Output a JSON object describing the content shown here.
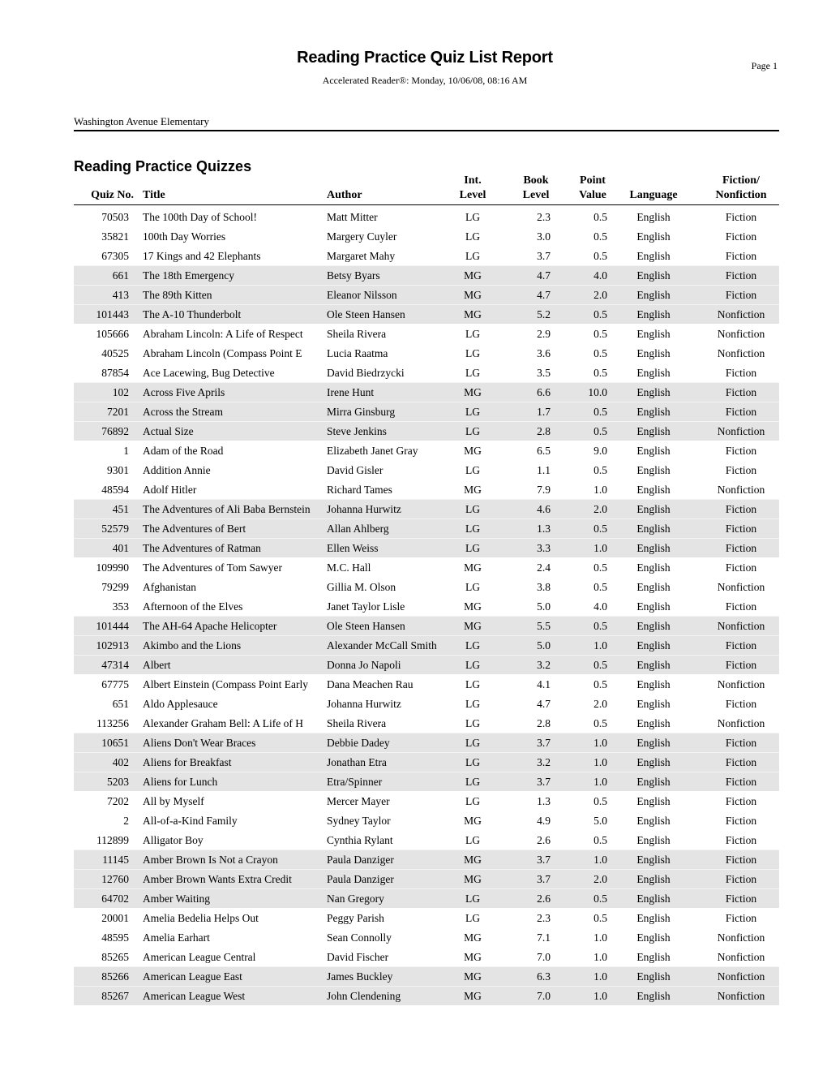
{
  "report": {
    "title": "Reading Practice Quiz List Report",
    "page_label": "Page 1",
    "subtitle": "Accelerated Reader®:  Monday, 10/06/08, 08:16 AM",
    "school": "Washington Avenue Elementary",
    "section_title": "Reading Practice Quizzes"
  },
  "table": {
    "headers": {
      "quiz_no": "Quiz No.",
      "title": "Title",
      "author": "Author",
      "int_level_1": "Int.",
      "int_level_2": "Level",
      "book_level_1": "Book",
      "book_level_2": "Level",
      "point_value_1": "Point",
      "point_value_2": "Value",
      "language": "Language",
      "fiction_1": "Fiction/",
      "fiction_2": "Nonfiction"
    },
    "shade_color": "#e4e4e4",
    "rows": [
      {
        "quiz": "70503",
        "title": "The 100th Day of School!",
        "author": "Matt Mitter",
        "int": "LG",
        "book": "2.3",
        "point": "0.5",
        "lang": "English",
        "fic": "Fiction"
      },
      {
        "quiz": "35821",
        "title": "100th Day Worries",
        "author": "Margery Cuyler",
        "int": "LG",
        "book": "3.0",
        "point": "0.5",
        "lang": "English",
        "fic": "Fiction"
      },
      {
        "quiz": "67305",
        "title": "17 Kings and 42 Elephants",
        "author": "Margaret Mahy",
        "int": "LG",
        "book": "3.7",
        "point": "0.5",
        "lang": "English",
        "fic": "Fiction"
      },
      {
        "quiz": "661",
        "title": "The 18th Emergency",
        "author": "Betsy Byars",
        "int": "MG",
        "book": "4.7",
        "point": "4.0",
        "lang": "English",
        "fic": "Fiction"
      },
      {
        "quiz": "413",
        "title": "The 89th Kitten",
        "author": "Eleanor Nilsson",
        "int": "MG",
        "book": "4.7",
        "point": "2.0",
        "lang": "English",
        "fic": "Fiction"
      },
      {
        "quiz": "101443",
        "title": "The A-10 Thunderbolt",
        "author": "Ole Steen Hansen",
        "int": "MG",
        "book": "5.2",
        "point": "0.5",
        "lang": "English",
        "fic": "Nonfiction"
      },
      {
        "quiz": "105666",
        "title": "Abraham Lincoln: A Life of Respect",
        "author": "Sheila Rivera",
        "int": "LG",
        "book": "2.9",
        "point": "0.5",
        "lang": "English",
        "fic": "Nonfiction"
      },
      {
        "quiz": "40525",
        "title": "Abraham Lincoln (Compass Point E",
        "author": "Lucia Raatma",
        "int": "LG",
        "book": "3.6",
        "point": "0.5",
        "lang": "English",
        "fic": "Nonfiction"
      },
      {
        "quiz": "87854",
        "title": "Ace Lacewing, Bug Detective",
        "author": "David Biedrzycki",
        "int": "LG",
        "book": "3.5",
        "point": "0.5",
        "lang": "English",
        "fic": "Fiction"
      },
      {
        "quiz": "102",
        "title": "Across Five Aprils",
        "author": "Irene Hunt",
        "int": "MG",
        "book": "6.6",
        "point": "10.0",
        "lang": "English",
        "fic": "Fiction"
      },
      {
        "quiz": "7201",
        "title": "Across the Stream",
        "author": "Mirra Ginsburg",
        "int": "LG",
        "book": "1.7",
        "point": "0.5",
        "lang": "English",
        "fic": "Fiction"
      },
      {
        "quiz": "76892",
        "title": "Actual Size",
        "author": "Steve Jenkins",
        "int": "LG",
        "book": "2.8",
        "point": "0.5",
        "lang": "English",
        "fic": "Nonfiction"
      },
      {
        "quiz": "1",
        "title": "Adam of the Road",
        "author": "Elizabeth Janet Gray",
        "int": "MG",
        "book": "6.5",
        "point": "9.0",
        "lang": "English",
        "fic": "Fiction"
      },
      {
        "quiz": "9301",
        "title": "Addition Annie",
        "author": "David Gisler",
        "int": "LG",
        "book": "1.1",
        "point": "0.5",
        "lang": "English",
        "fic": "Fiction"
      },
      {
        "quiz": "48594",
        "title": "Adolf Hitler",
        "author": "Richard Tames",
        "int": "MG",
        "book": "7.9",
        "point": "1.0",
        "lang": "English",
        "fic": "Nonfiction"
      },
      {
        "quiz": "451",
        "title": "The Adventures of Ali Baba Bernstein",
        "author": "Johanna Hurwitz",
        "int": "LG",
        "book": "4.6",
        "point": "2.0",
        "lang": "English",
        "fic": "Fiction"
      },
      {
        "quiz": "52579",
        "title": "The Adventures of Bert",
        "author": "Allan Ahlberg",
        "int": "LG",
        "book": "1.3",
        "point": "0.5",
        "lang": "English",
        "fic": "Fiction"
      },
      {
        "quiz": "401",
        "title": "The Adventures of Ratman",
        "author": "Ellen Weiss",
        "int": "LG",
        "book": "3.3",
        "point": "1.0",
        "lang": "English",
        "fic": "Fiction"
      },
      {
        "quiz": "109990",
        "title": "The Adventures of Tom Sawyer",
        "author": "M.C. Hall",
        "int": "MG",
        "book": "2.4",
        "point": "0.5",
        "lang": "English",
        "fic": "Fiction"
      },
      {
        "quiz": "79299",
        "title": "Afghanistan",
        "author": "Gillia M. Olson",
        "int": "LG",
        "book": "3.8",
        "point": "0.5",
        "lang": "English",
        "fic": "Nonfiction"
      },
      {
        "quiz": "353",
        "title": "Afternoon of the Elves",
        "author": "Janet Taylor Lisle",
        "int": "MG",
        "book": "5.0",
        "point": "4.0",
        "lang": "English",
        "fic": "Fiction"
      },
      {
        "quiz": "101444",
        "title": "The AH-64 Apache Helicopter",
        "author": "Ole Steen Hansen",
        "int": "MG",
        "book": "5.5",
        "point": "0.5",
        "lang": "English",
        "fic": "Nonfiction"
      },
      {
        "quiz": "102913",
        "title": "Akimbo and the Lions",
        "author": "Alexander McCall Smith",
        "int": "LG",
        "book": "5.0",
        "point": "1.0",
        "lang": "English",
        "fic": "Fiction"
      },
      {
        "quiz": "47314",
        "title": "Albert",
        "author": "Donna Jo Napoli",
        "int": "LG",
        "book": "3.2",
        "point": "0.5",
        "lang": "English",
        "fic": "Fiction"
      },
      {
        "quiz": "67775",
        "title": "Albert Einstein (Compass Point Early",
        "author": "Dana Meachen Rau",
        "int": "LG",
        "book": "4.1",
        "point": "0.5",
        "lang": "English",
        "fic": "Nonfiction"
      },
      {
        "quiz": "651",
        "title": "Aldo Applesauce",
        "author": "Johanna Hurwitz",
        "int": "LG",
        "book": "4.7",
        "point": "2.0",
        "lang": "English",
        "fic": "Fiction"
      },
      {
        "quiz": "113256",
        "title": "Alexander Graham Bell: A Life of H",
        "author": "Sheila Rivera",
        "int": "LG",
        "book": "2.8",
        "point": "0.5",
        "lang": "English",
        "fic": "Nonfiction"
      },
      {
        "quiz": "10651",
        "title": "Aliens Don't Wear Braces",
        "author": "Debbie Dadey",
        "int": "LG",
        "book": "3.7",
        "point": "1.0",
        "lang": "English",
        "fic": "Fiction"
      },
      {
        "quiz": "402",
        "title": "Aliens for Breakfast",
        "author": "Jonathan Etra",
        "int": "LG",
        "book": "3.2",
        "point": "1.0",
        "lang": "English",
        "fic": "Fiction"
      },
      {
        "quiz": "5203",
        "title": "Aliens for Lunch",
        "author": "Etra/Spinner",
        "int": "LG",
        "book": "3.7",
        "point": "1.0",
        "lang": "English",
        "fic": "Fiction"
      },
      {
        "quiz": "7202",
        "title": "All by Myself",
        "author": "Mercer Mayer",
        "int": "LG",
        "book": "1.3",
        "point": "0.5",
        "lang": "English",
        "fic": "Fiction"
      },
      {
        "quiz": "2",
        "title": "All-of-a-Kind Family",
        "author": "Sydney Taylor",
        "int": "MG",
        "book": "4.9",
        "point": "5.0",
        "lang": "English",
        "fic": "Fiction"
      },
      {
        "quiz": "112899",
        "title": "Alligator Boy",
        "author": "Cynthia Rylant",
        "int": "LG",
        "book": "2.6",
        "point": "0.5",
        "lang": "English",
        "fic": "Fiction"
      },
      {
        "quiz": "11145",
        "title": "Amber Brown Is Not a Crayon",
        "author": "Paula Danziger",
        "int": "MG",
        "book": "3.7",
        "point": "1.0",
        "lang": "English",
        "fic": "Fiction"
      },
      {
        "quiz": "12760",
        "title": "Amber Brown Wants Extra Credit",
        "author": "Paula Danziger",
        "int": "MG",
        "book": "3.7",
        "point": "2.0",
        "lang": "English",
        "fic": "Fiction"
      },
      {
        "quiz": "64702",
        "title": "Amber Waiting",
        "author": "Nan Gregory",
        "int": "LG",
        "book": "2.6",
        "point": "0.5",
        "lang": "English",
        "fic": "Fiction"
      },
      {
        "quiz": "20001",
        "title": "Amelia Bedelia Helps Out",
        "author": "Peggy Parish",
        "int": "LG",
        "book": "2.3",
        "point": "0.5",
        "lang": "English",
        "fic": "Fiction"
      },
      {
        "quiz": "48595",
        "title": "Amelia Earhart",
        "author": "Sean Connolly",
        "int": "MG",
        "book": "7.1",
        "point": "1.0",
        "lang": "English",
        "fic": "Nonfiction"
      },
      {
        "quiz": "85265",
        "title": "American League Central",
        "author": "David Fischer",
        "int": "MG",
        "book": "7.0",
        "point": "1.0",
        "lang": "English",
        "fic": "Nonfiction"
      },
      {
        "quiz": "85266",
        "title": "American League East",
        "author": "James Buckley",
        "int": "MG",
        "book": "6.3",
        "point": "1.0",
        "lang": "English",
        "fic": "Nonfiction"
      },
      {
        "quiz": "85267",
        "title": "American League West",
        "author": "John Clendening",
        "int": "MG",
        "book": "7.0",
        "point": "1.0",
        "lang": "English",
        "fic": "Nonfiction"
      }
    ]
  }
}
